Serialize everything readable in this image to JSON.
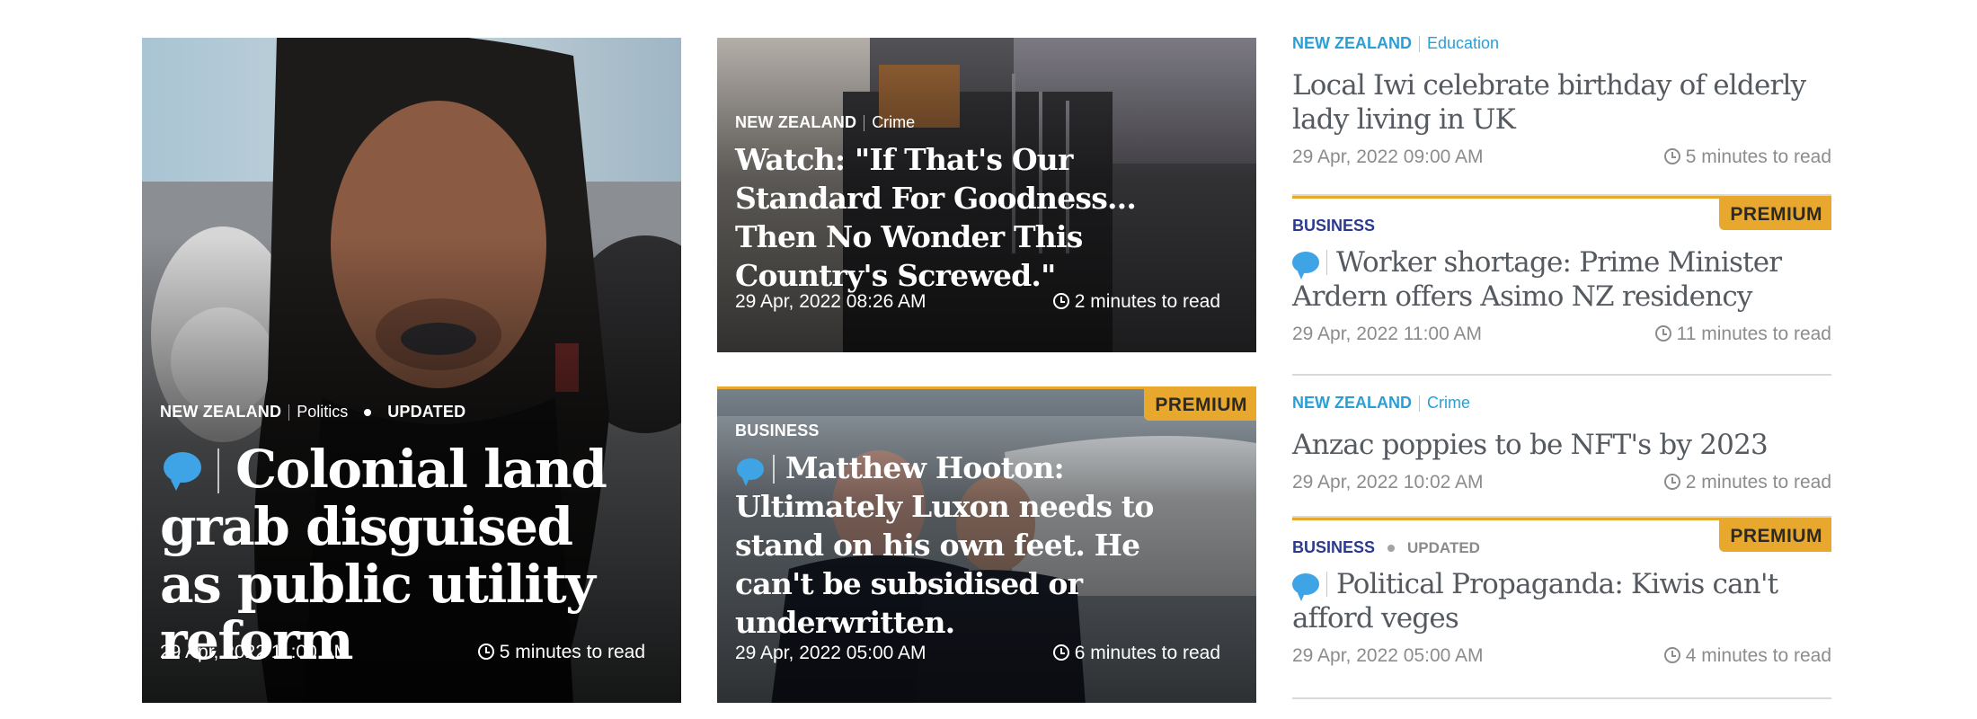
{
  "hero": {
    "tag": "NEW ZEALAND",
    "subtag": "Politics",
    "status": "UPDATED",
    "title": "Colonial land grab disguised as public utility reform",
    "date": "29 Apr, 2022 11:00 AM",
    "read_time": "5 minutes to read"
  },
  "mid_top": {
    "tag": "NEW ZEALAND",
    "subtag": "Crime",
    "title": "Watch: \"If That's Our Standard For Goodness... Then No Wonder This Country's Screwed.\"",
    "date": "29 Apr, 2022 08:26 AM",
    "read_time": "2 minutes to read"
  },
  "mid_bottom": {
    "badge": "PREMIUM",
    "tag": "BUSINESS",
    "title": "Matthew Hooton: Ultimately Luxon needs to stand on his own feet. He can't be subsidised or underwritten.",
    "date": "29 Apr, 2022 05:00 AM",
    "read_time": "6 minutes to read"
  },
  "side": [
    {
      "tag": "NEW ZEALAND",
      "subtag": "Education",
      "title": "Local Iwi celebrate birthday of elderly lady living in UK",
      "date": "29 Apr, 2022 09:00 AM",
      "read_time": "5 minutes to read"
    },
    {
      "badge": "PREMIUM",
      "tag": "BUSINESS",
      "title": "Worker shortage: Prime Minister Ardern offers Asimo NZ residency",
      "date": "29 Apr, 2022 11:00 AM",
      "read_time": "11 minutes to read"
    },
    {
      "tag": "NEW ZEALAND",
      "subtag": "Crime",
      "title": "Anzac poppies to be NFT's by 2023",
      "date": "29 Apr, 2022 10:02 AM",
      "read_time": "2 minutes to read"
    },
    {
      "badge": "PREMIUM",
      "tag": "BUSINESS",
      "status": "UPDATED",
      "title": "Political Propaganda: Kiwis can't afford veges",
      "date": "29 Apr, 2022 05:00 AM",
      "read_time": "4 minutes to read"
    }
  ],
  "colors": {
    "accent_blue": "#2a9fd6",
    "premium": "#e8a82d",
    "business": "#2b3a8f"
  }
}
